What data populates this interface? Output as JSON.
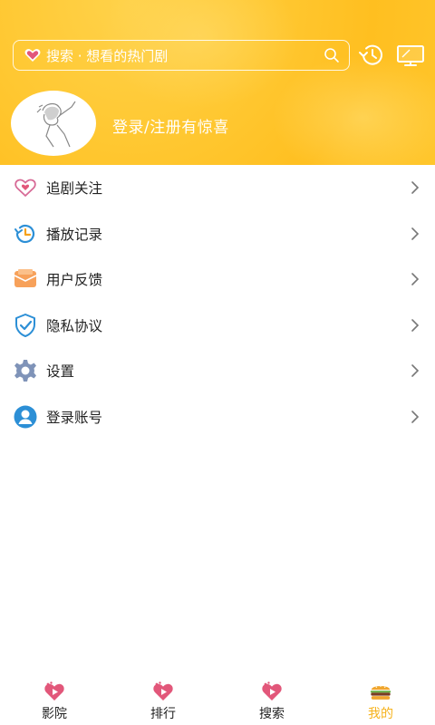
{
  "search": {
    "text": "搜索 · 想看的热门剧"
  },
  "user": {
    "login_prompt": "登录/注册有惊喜"
  },
  "menu": [
    {
      "label": "追剧关注",
      "icon": "heart-outline-icon"
    },
    {
      "label": "播放记录",
      "icon": "history-clock-icon"
    },
    {
      "label": "用户反馈",
      "icon": "mail-envelope-icon"
    },
    {
      "label": "隐私协议",
      "icon": "shield-check-icon"
    },
    {
      "label": "设置",
      "icon": "gear-icon"
    },
    {
      "label": "登录账号",
      "icon": "user-circle-icon"
    }
  ],
  "tabs": [
    {
      "label": "影院",
      "icon": "play-heart-icon",
      "active": false
    },
    {
      "label": "排行",
      "icon": "play-heart-icon",
      "active": false
    },
    {
      "label": "搜索",
      "icon": "play-heart-icon",
      "active": false
    },
    {
      "label": "我的",
      "icon": "burger-icon",
      "active": true
    }
  ],
  "colors": {
    "header": "#ffc32a",
    "accent": "#f6b21b",
    "heart": "#e2577a",
    "icon_blue": "#2c8fd6"
  }
}
